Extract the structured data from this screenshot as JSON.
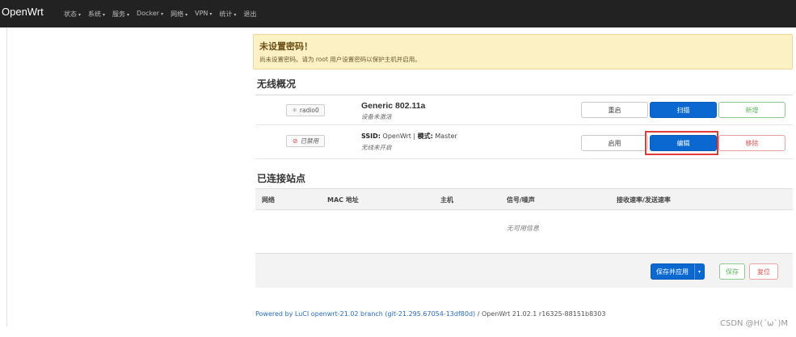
{
  "brand": "OpenWrt",
  "menu": [
    {
      "label": "状态",
      "caret": true
    },
    {
      "label": "系统",
      "caret": true
    },
    {
      "label": "服务",
      "caret": true
    },
    {
      "label": "Docker",
      "caret": true
    },
    {
      "label": "网络",
      "caret": true
    },
    {
      "label": "VPN",
      "caret": true
    },
    {
      "label": "统计",
      "caret": true
    },
    {
      "label": "退出",
      "caret": false
    }
  ],
  "caret_glyph": "▾",
  "alert": {
    "title": "未设置密码！",
    "message": "尚未设置密码。请为 root 用户设置密码以保护主机并启用。"
  },
  "wireless": {
    "title": "无线概况",
    "radio": {
      "badge": "radio0",
      "name": "Generic 802.11a",
      "status": "设备未激活",
      "buttons": {
        "restart": "重启",
        "scan": "扫描",
        "add": "新增"
      }
    },
    "network": {
      "badge": "已禁用",
      "ssid_label": "SSID:",
      "ssid_value": "OpenWrt",
      "mode_label": "模式:",
      "mode_value": "Master",
      "status": "无线未开启",
      "buttons": {
        "enable": "启用",
        "edit": "编辑",
        "remove": "移除"
      }
    }
  },
  "stations": {
    "title": "已连接站点",
    "columns": [
      "网络",
      "MAC 地址",
      "主机",
      "信号/噪声",
      "接收速率/发送速率"
    ],
    "empty": "无可用信息"
  },
  "actions": {
    "save_apply": "保存并应用",
    "save": "保存",
    "reset": "复位"
  },
  "footer": {
    "link": "Powered by LuCI openwrt-21.02 branch (git-21.295.67054-13df80d)",
    "version": "/ OpenWrt 21.02.1 r16325-88151b8303"
  },
  "watermark": "CSDN @H(ˊωˋ)M",
  "colors": {
    "topbar": "#222222",
    "primary": "#0b68d1",
    "positive": "#5cb85c",
    "negative": "#d9534f",
    "alert_bg": "#fcf1c4",
    "highlight": "#e03b3b"
  }
}
